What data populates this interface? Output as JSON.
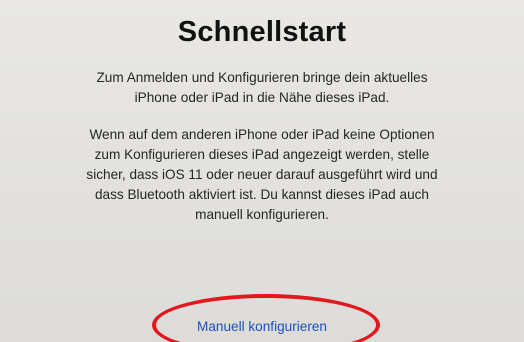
{
  "quickstart": {
    "title": "Schnellstart",
    "paragraph_1": "Zum Anmelden und Konfigurieren bringe dein aktuelles\niPhone oder iPad in die Nähe dieses iPad.",
    "paragraph_2": "Wenn auf dem anderen iPhone oder iPad keine Optionen\nzum Konfigurieren dieses iPad angezeigt werden, stelle\nsicher, dass iOS 11 oder neuer darauf ausgeführt wird und\ndass Bluetooth aktiviert ist. Du kannst dieses iPad auch\nmanuell konfigurieren.",
    "manual_link_label": "Manuell konfigurieren"
  },
  "colors": {
    "link": "#1f4fb8",
    "highlight_circle": "#e3171e"
  }
}
